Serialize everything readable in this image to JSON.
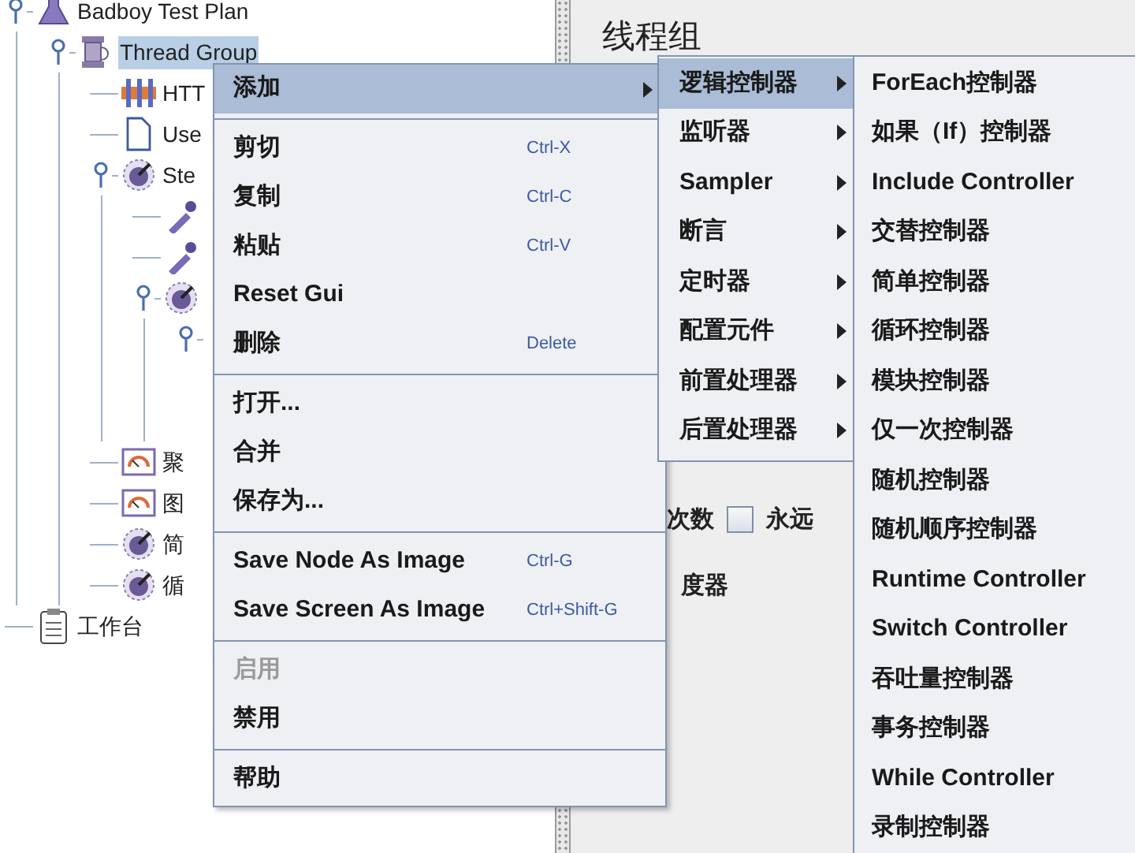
{
  "tree": [
    {
      "label": "Badboy Test Plan",
      "kind": "plan",
      "expanded": true,
      "selected": false,
      "children": [
        {
          "label": "Thread Group",
          "kind": "threads",
          "expanded": true,
          "selected": true,
          "children": [
            {
              "label": "HTT",
              "kind": "http",
              "selected": false
            },
            {
              "label": "Use",
              "kind": "doc",
              "selected": false
            },
            {
              "label": "Ste",
              "kind": "dial",
              "expanded": true,
              "selected": false,
              "children": [
                {
                  "kind": "dropper",
                  "selected": false
                },
                {
                  "kind": "dropper",
                  "selected": false
                },
                {
                  "kind": "dial",
                  "expanded": true,
                  "selected": false,
                  "children": [
                    {
                      "kind": "blank",
                      "expanded": true,
                      "selected": false
                    }
                  ]
                }
              ]
            },
            {
              "label": "聚",
              "kind": "gauge",
              "selected": false
            },
            {
              "label": "图",
              "kind": "gauge",
              "selected": false
            },
            {
              "label": "简",
              "kind": "dial",
              "selected": false
            },
            {
              "label": "循",
              "kind": "dial",
              "selected": false
            }
          ]
        }
      ]
    },
    {
      "label": "工作台",
      "kind": "clipboard",
      "selected": false
    }
  ],
  "panel": {
    "title": "线程组",
    "loop_label": "次数",
    "forever": {
      "label": "永远",
      "checked": false
    },
    "scheduler_label": "度器"
  },
  "context_menu": {
    "sections": [
      [
        {
          "label": "添加",
          "submenu": true,
          "selected": true,
          "disabled": false
        }
      ],
      [
        {
          "label": "剪切",
          "shortcut": "Ctrl-X",
          "selected": false,
          "disabled": false
        },
        {
          "label": "复制",
          "shortcut": "Ctrl-C",
          "selected": false,
          "disabled": false
        },
        {
          "label": "粘贴",
          "shortcut": "Ctrl-V",
          "selected": false,
          "disabled": false
        },
        {
          "label": "Reset Gui",
          "selected": false,
          "disabled": false
        },
        {
          "label": "删除",
          "shortcut": "Delete",
          "selected": false,
          "disabled": false
        }
      ],
      [
        {
          "label": "打开...",
          "selected": false,
          "disabled": false
        },
        {
          "label": "合并",
          "selected": false,
          "disabled": false
        },
        {
          "label": "保存为...",
          "selected": false,
          "disabled": false
        }
      ],
      [
        {
          "label": "Save Node As Image",
          "shortcut": "Ctrl-G",
          "selected": false,
          "disabled": false
        },
        {
          "label": "Save Screen As Image",
          "shortcut": "Ctrl+Shift-G",
          "selected": false,
          "disabled": false
        }
      ],
      [
        {
          "label": "启用",
          "selected": false,
          "disabled": true
        },
        {
          "label": "禁用",
          "selected": false,
          "disabled": false
        }
      ],
      [
        {
          "label": "帮助",
          "selected": false,
          "disabled": false
        }
      ]
    ]
  },
  "add_submenu": [
    {
      "label": "逻辑控制器",
      "selected": true
    },
    {
      "label": "监听器",
      "selected": false
    },
    {
      "label": "Sampler",
      "selected": false
    },
    {
      "label": "断言",
      "selected": false
    },
    {
      "label": "定时器",
      "selected": false
    },
    {
      "label": "配置元件",
      "selected": false
    },
    {
      "label": "前置处理器",
      "selected": false
    },
    {
      "label": "后置处理器",
      "selected": false
    }
  ],
  "logic_controller_submenu": [
    {
      "label": "ForEach控制器",
      "selected": false
    },
    {
      "label": "如果（If）控制器",
      "selected": false
    },
    {
      "label": "Include Controller",
      "selected": false
    },
    {
      "label": "交替控制器",
      "selected": false
    },
    {
      "label": "简单控制器",
      "selected": false
    },
    {
      "label": "循环控制器",
      "selected": false
    },
    {
      "label": "模块控制器",
      "selected": false
    },
    {
      "label": "仅一次控制器",
      "selected": false
    },
    {
      "label": "随机控制器",
      "selected": false
    },
    {
      "label": "随机顺序控制器",
      "selected": false
    },
    {
      "label": "Runtime Controller",
      "selected": false
    },
    {
      "label": "Switch Controller",
      "selected": false
    },
    {
      "label": "吞吐量控制器",
      "selected": false
    },
    {
      "label": "事务控制器",
      "selected": false
    },
    {
      "label": "While Controller",
      "selected": false
    },
    {
      "label": "录制控制器",
      "selected": false
    }
  ]
}
